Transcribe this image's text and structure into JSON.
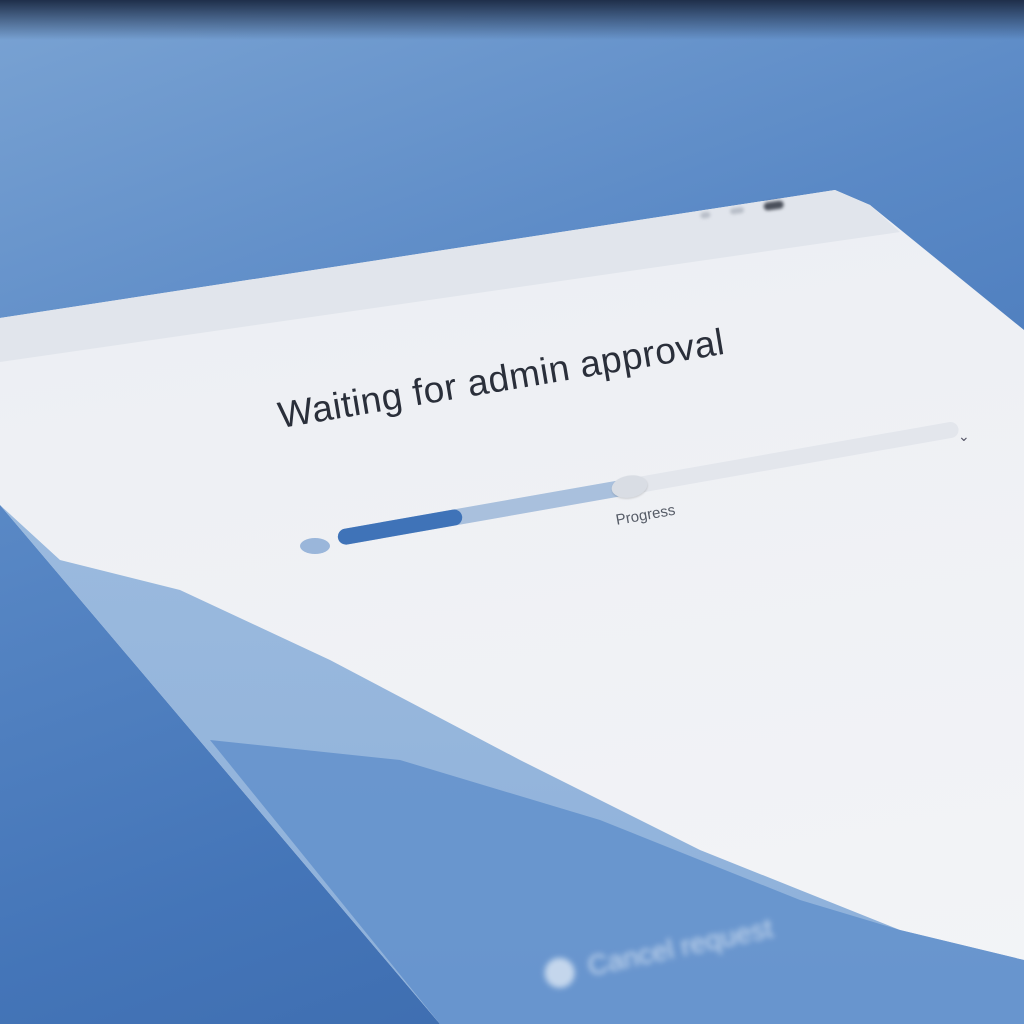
{
  "dialog": {
    "title": "Waiting for admin approval",
    "progress_label": "Progress",
    "progress_fraction": 0.2,
    "buffer_fraction": 0.47,
    "bottom_button_label": "Cancel request"
  },
  "colors": {
    "accent": "#3f73b8",
    "buffer": "#a9c0dd",
    "background": "#4a7abb"
  }
}
